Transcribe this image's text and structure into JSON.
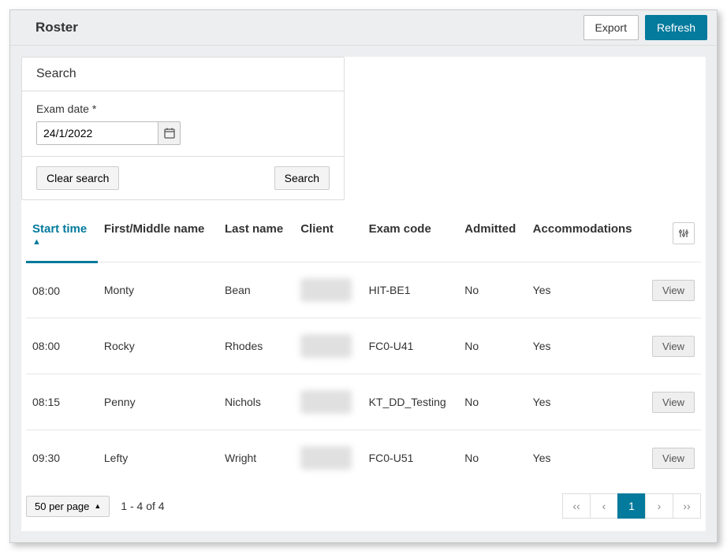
{
  "header": {
    "title": "Roster",
    "export_label": "Export",
    "refresh_label": "Refresh"
  },
  "search": {
    "heading": "Search",
    "date_label": "Exam date *",
    "date_value": "24/1/2022",
    "clear_label": "Clear search",
    "search_label": "Search"
  },
  "columns": {
    "start_time": "Start time",
    "first_name": "First/Middle name",
    "last_name": "Last name",
    "client": "Client",
    "exam_code": "Exam code",
    "admitted": "Admitted",
    "accommodations": "Accommodations"
  },
  "rows": [
    {
      "start": "08:00",
      "first": "Monty",
      "last": "Bean",
      "exam": "HIT-BE1",
      "admitted": "No",
      "accom": "Yes",
      "view": "View"
    },
    {
      "start": "08:00",
      "first": "Rocky",
      "last": "Rhodes",
      "exam": "FC0-U41",
      "admitted": "No",
      "accom": "Yes",
      "view": "View"
    },
    {
      "start": "08:15",
      "first": "Penny",
      "last": "Nichols",
      "exam": "KT_DD_Testing",
      "admitted": "No",
      "accom": "Yes",
      "view": "View"
    },
    {
      "start": "09:30",
      "first": "Lefty",
      "last": "Wright",
      "exam": "FC0-U51",
      "admitted": "No",
      "accom": "Yes",
      "view": "View"
    }
  ],
  "footer": {
    "perpage": "50 per page",
    "range": "1 - 4 of 4",
    "pager": {
      "first": "‹‹",
      "prev": "‹",
      "page": "1",
      "next": "›",
      "last": "››"
    }
  }
}
